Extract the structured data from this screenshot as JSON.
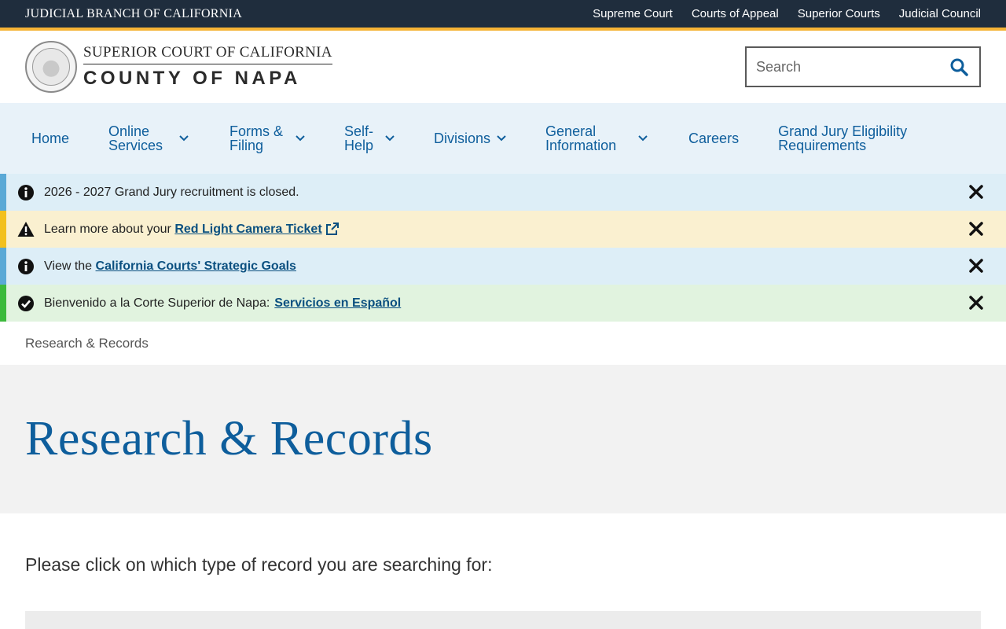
{
  "topbar": {
    "brand": "JUDICIAL BRANCH OF CALIFORNIA",
    "links": [
      "Supreme Court",
      "Courts of Appeal",
      "Superior Courts",
      "Judicial Council"
    ]
  },
  "header": {
    "logo_line1": "SUPERIOR COURT OF CALIFORNIA",
    "logo_line2": "COUNTY OF NAPA",
    "search_placeholder": "Search"
  },
  "nav": {
    "items": [
      {
        "label": "Home",
        "dropdown": false
      },
      {
        "label": "Online Services",
        "dropdown": true
      },
      {
        "label": "Forms & Filing",
        "dropdown": true
      },
      {
        "label": "Self-Help",
        "dropdown": true
      },
      {
        "label": "Divisions",
        "dropdown": true
      },
      {
        "label": "General Information",
        "dropdown": true
      },
      {
        "label": "Careers",
        "dropdown": false
      },
      {
        "label": "Grand Jury Eligibility Requirements",
        "dropdown": false
      }
    ]
  },
  "alerts": [
    {
      "type": "info",
      "text": "2026 - 2027 Grand Jury recruitment is closed."
    },
    {
      "type": "warning",
      "text": "Learn more about your ",
      "link": "Red Light Camera Ticket"
    },
    {
      "type": "info",
      "text": "View the ",
      "link": "California Courts' Strategic Goals"
    },
    {
      "type": "success",
      "text": "Bienvenido a la Corte Superior de Napa:",
      "link": "Servicios en Español"
    }
  ],
  "breadcrumb": "Research & Records",
  "page": {
    "title": "Research & Records",
    "intro": "Please click on which type of record you are searching for:"
  },
  "colors": {
    "topbar": "#1f2d3d",
    "accent_gold": "#f5b335",
    "link_blue": "#0e5e9c",
    "nav_bg": "#e8f2f9"
  }
}
